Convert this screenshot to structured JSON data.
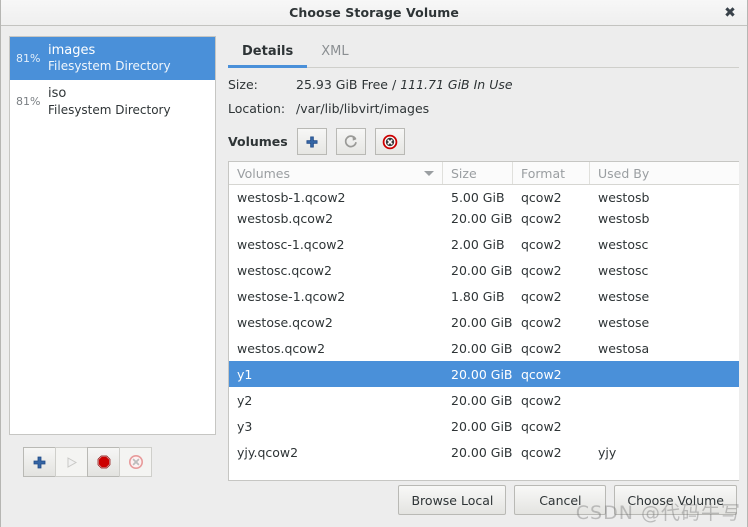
{
  "window": {
    "title": "Choose Storage Volume",
    "close_label": "✖"
  },
  "sidebar": {
    "pools": [
      {
        "percent": "81%",
        "name": "images",
        "type": "Filesystem Directory",
        "selected": true
      },
      {
        "percent": "81%",
        "name": "iso",
        "type": "Filesystem Directory",
        "selected": false
      }
    ],
    "toolbar": [
      {
        "name": "add-pool-button",
        "icon": "plus-icon",
        "enabled": true
      },
      {
        "name": "start-pool-button",
        "icon": "play-icon",
        "enabled": false
      },
      {
        "name": "stop-pool-button",
        "icon": "stop-icon",
        "enabled": true
      },
      {
        "name": "delete-pool-button",
        "icon": "delete-icon",
        "enabled": false
      }
    ]
  },
  "tabs": [
    {
      "label": "Details",
      "active": true
    },
    {
      "label": "XML",
      "active": false
    }
  ],
  "details": {
    "size_label": "Size:",
    "size_free": "25.93 GiB Free",
    "size_sep": "/",
    "size_used": "111.71 GiB In Use",
    "location_label": "Location:",
    "location_value": "/var/lib/libvirt/images",
    "volumes_label": "Volumes",
    "volume_buttons": [
      {
        "name": "add-volume-button",
        "icon": "plus-icon"
      },
      {
        "name": "refresh-volumes-button",
        "icon": "refresh-icon"
      },
      {
        "name": "delete-volume-button",
        "icon": "delete-circle-icon"
      }
    ]
  },
  "table": {
    "columns": [
      "Volumes",
      "Size",
      "Format",
      "Used By"
    ],
    "sort_column": "Volumes",
    "rows": [
      {
        "volume": "westosb-1.qcow2",
        "size": "5.00 GiB",
        "format": "qcow2",
        "used_by": "westosb",
        "selected": false,
        "partial": true
      },
      {
        "volume": "westosb.qcow2",
        "size": "20.00 GiB",
        "format": "qcow2",
        "used_by": "westosb",
        "selected": false,
        "partial": false
      },
      {
        "volume": "westosc-1.qcow2",
        "size": "2.00 GiB",
        "format": "qcow2",
        "used_by": "westosc",
        "selected": false,
        "partial": false
      },
      {
        "volume": "westosc.qcow2",
        "size": "20.00 GiB",
        "format": "qcow2",
        "used_by": "westosc",
        "selected": false,
        "partial": false
      },
      {
        "volume": "westose-1.qcow2",
        "size": "1.80 GiB",
        "format": "qcow2",
        "used_by": "westose",
        "selected": false,
        "partial": false
      },
      {
        "volume": "westose.qcow2",
        "size": "20.00 GiB",
        "format": "qcow2",
        "used_by": "westose",
        "selected": false,
        "partial": false
      },
      {
        "volume": "westos.qcow2",
        "size": "20.00 GiB",
        "format": "qcow2",
        "used_by": "westosa",
        "selected": false,
        "partial": false
      },
      {
        "volume": "y1",
        "size": "20.00 GiB",
        "format": "qcow2",
        "used_by": "",
        "selected": true,
        "partial": false
      },
      {
        "volume": "y2",
        "size": "20.00 GiB",
        "format": "qcow2",
        "used_by": "",
        "selected": false,
        "partial": false
      },
      {
        "volume": "y3",
        "size": "20.00 GiB",
        "format": "qcow2",
        "used_by": "",
        "selected": false,
        "partial": false
      },
      {
        "volume": "yjy.qcow2",
        "size": "20.00 GiB",
        "format": "qcow2",
        "used_by": "yjy",
        "selected": false,
        "partial": false
      }
    ]
  },
  "footer": {
    "browse_local": "Browse Local",
    "cancel": "Cancel",
    "choose_volume": "Choose Volume"
  },
  "watermark": "CSDN @代码牛写",
  "colors": {
    "selection_blue": "#4a90d9",
    "accent_underline": "#4a90d9",
    "window_bg": "#ededed",
    "text": "#2e3436",
    "muted_text": "#9a9ea1",
    "stop_red": "#cc0000",
    "plus_blue": "#3465a4"
  }
}
